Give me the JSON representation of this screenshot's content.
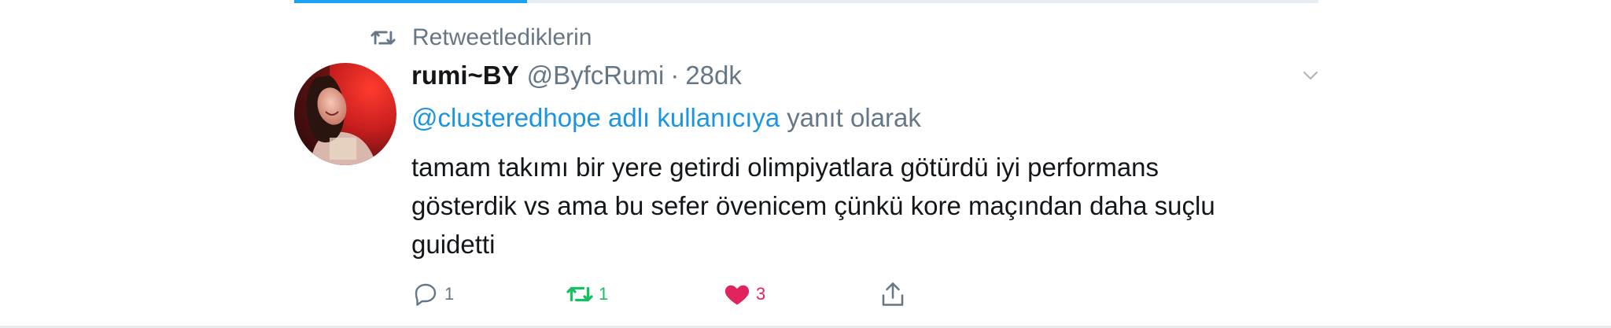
{
  "colors": {
    "accent_blue": "#1da1f2",
    "mention_blue": "#1b95e0",
    "muted_gray": "#657786",
    "text_dark": "#14171a",
    "retweet_green": "#17bf63",
    "like_red": "#e0245e"
  },
  "context": {
    "retweet_label": "Retweetlediklerin",
    "icon": "retweet-icon"
  },
  "tweet": {
    "display_name": "rumi~BY",
    "handle": "@ByfcRumi",
    "separator": "·",
    "time": "28dk",
    "reply_to": {
      "mention": "@clusteredhope adlı kullanıcıya",
      "suffix": "yanıt olarak"
    },
    "text_lines": [
      "tamam takımı bir yere getirdi olimpiyatlara götürdü iyi performans",
      "gösterdik vs ama bu sefer övenicem çünkü kore maçından daha suçlu",
      "guidetti"
    ],
    "actions": {
      "reply_count": "1",
      "retweet_count": "1",
      "like_count": "3",
      "share_icon": "share-icon"
    }
  }
}
